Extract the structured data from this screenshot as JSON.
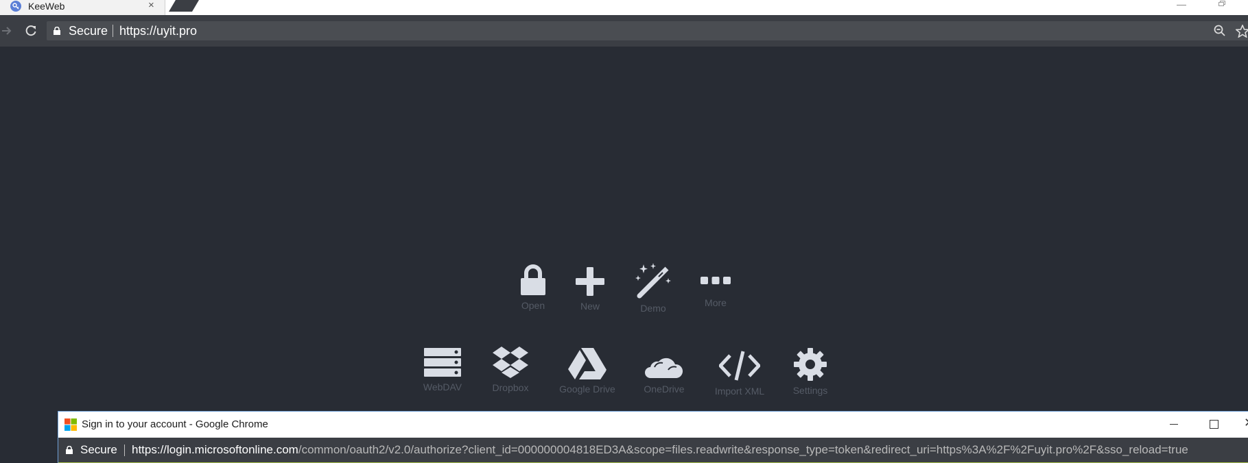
{
  "browser": {
    "tab": {
      "title": "KeeWeb",
      "close": "×"
    },
    "address": {
      "secure_label": "Secure",
      "url": "https://uyit.pro"
    }
  },
  "app": {
    "actions": [
      {
        "label": "Open",
        "icon": "lock-icon"
      },
      {
        "label": "New",
        "icon": "plus-icon"
      },
      {
        "label": "Demo",
        "icon": "magic-wand-icon"
      },
      {
        "label": "More",
        "icon": "ellipsis-icon"
      }
    ],
    "storage": [
      {
        "label": "WebDAV",
        "icon": "server-icon"
      },
      {
        "label": "Dropbox",
        "icon": "dropbox-icon"
      },
      {
        "label": "Google Drive",
        "icon": "google-drive-icon"
      },
      {
        "label": "OneDrive",
        "icon": "cloud-icon"
      },
      {
        "label": "Import XML",
        "icon": "code-icon"
      },
      {
        "label": "Settings",
        "icon": "gear-icon"
      }
    ]
  },
  "popup": {
    "title": "Sign in to your account - Google Chrome",
    "secure_label": "Secure",
    "url_host": "https://login.microsoftonline.com",
    "url_path": "/common/oauth2/v2.0/authorize?client_id=000000004818ED3A&scope=files.readwrite&response_type=token&redirect_uri=https%3A%2F%2Fuyit.pro%2F&sso_reload=true",
    "close": "✕"
  },
  "colors": {
    "app_background": "#282c34",
    "icon": "#d9dde5",
    "label": "#555b66",
    "toolbar": "#3b3e44"
  }
}
